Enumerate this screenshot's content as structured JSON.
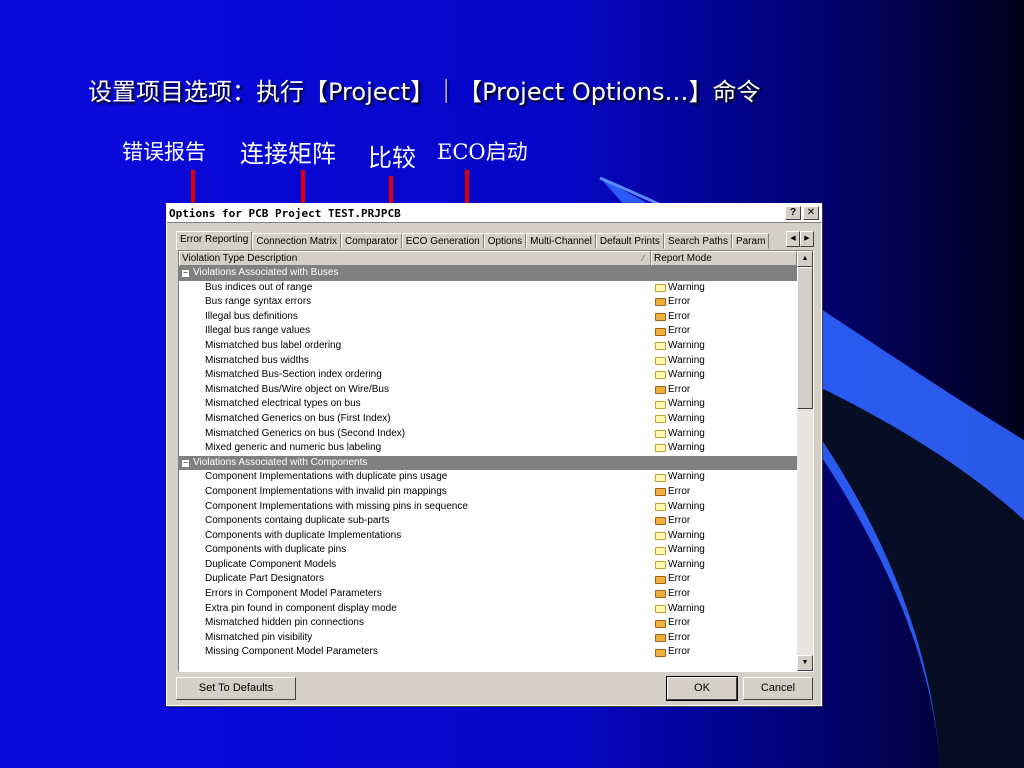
{
  "slide": {
    "title": "设置项目选项：执行【Project】｜【Project Options…】命令",
    "callouts": [
      "错误报告",
      "连接矩阵",
      "比较",
      "ECO启动"
    ]
  },
  "colors": {
    "arrow": "#e00000",
    "group_row": "#808080",
    "background": "#0a0ae0"
  },
  "dialog": {
    "title": "Options for PCB Project TEST.PRJPCB",
    "help_button": "?",
    "close_button": "✕",
    "tabs": [
      "Error Reporting",
      "Connection Matrix",
      "Comparator",
      "ECO Generation",
      "Options",
      "Multi-Channel",
      "Default Prints",
      "Search Paths",
      "Param"
    ],
    "active_tab": "Error Reporting",
    "columns": [
      "Violation Type Description",
      "Report Mode"
    ],
    "groups": [
      {
        "name": "Violations Associated with Buses",
        "rows": [
          [
            "Bus indices out of range",
            "Warning"
          ],
          [
            "Bus range syntax errors",
            "Error"
          ],
          [
            "Illegal bus definitions",
            "Error"
          ],
          [
            "Illegal bus range values",
            "Error"
          ],
          [
            "Mismatched bus label ordering",
            "Warning"
          ],
          [
            "Mismatched bus widths",
            "Warning"
          ],
          [
            "Mismatched Bus-Section index ordering",
            "Warning"
          ],
          [
            "Mismatched Bus/Wire object on Wire/Bus",
            "Error"
          ],
          [
            "Mismatched electrical types on bus",
            "Warning"
          ],
          [
            "Mismatched Generics on bus (First Index)",
            "Warning"
          ],
          [
            "Mismatched Generics on bus (Second Index)",
            "Warning"
          ],
          [
            "Mixed generic and numeric bus labeling",
            "Warning"
          ]
        ]
      },
      {
        "name": "Violations Associated with Components",
        "rows": [
          [
            "Component Implementations with duplicate pins usage",
            "Warning"
          ],
          [
            "Component Implementations with invalid pin mappings",
            "Error"
          ],
          [
            "Component Implementations with missing pins in sequence",
            "Warning"
          ],
          [
            "Components containg duplicate sub-parts",
            "Error"
          ],
          [
            "Components with duplicate Implementations",
            "Warning"
          ],
          [
            "Components with duplicate pins",
            "Warning"
          ],
          [
            "Duplicate Component Models",
            "Warning"
          ],
          [
            "Duplicate Part Designators",
            "Error"
          ],
          [
            "Errors in Component Model Parameters",
            "Error"
          ],
          [
            "Extra pin found in component display mode",
            "Warning"
          ],
          [
            "Mismatched hidden pin connections",
            "Error"
          ],
          [
            "Mismatched pin visibility",
            "Error"
          ],
          [
            "Missing Component Model Parameters",
            "Error"
          ]
        ]
      }
    ],
    "buttons": {
      "defaults": "Set To Defaults",
      "ok": "OK",
      "cancel": "Cancel"
    }
  }
}
